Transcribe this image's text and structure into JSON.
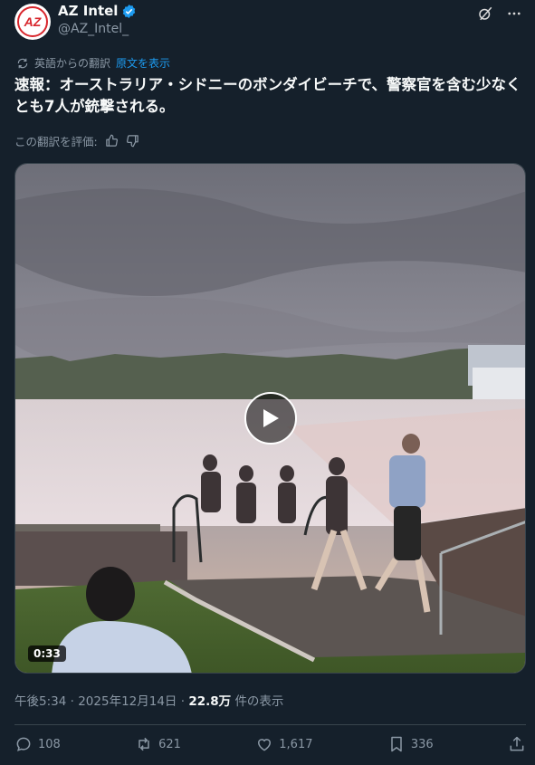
{
  "author": {
    "name": "AZ Intel",
    "handle": "@AZ_Intel_",
    "avatar_text": "AZ",
    "verified": true
  },
  "translation": {
    "label": "英語からの翻訳",
    "show_original": "原文を表示",
    "rate_label": "この翻訳を評価:"
  },
  "post": {
    "text": "速報：オーストラリア・シドニーのボンダイビーチで、警察官を含む少なくとも7人が銃撃される。"
  },
  "media": {
    "duration": "0:33"
  },
  "meta": {
    "time": "午後5:34",
    "date": "2025年12月14日",
    "views": "22.8万",
    "views_suffix": "件の表示"
  },
  "actions": {
    "replies": "108",
    "reposts": "621",
    "likes": "1,617",
    "bookmarks": "336"
  },
  "colors": {
    "background": "#15202b",
    "accent": "#1d9bf0",
    "muted": "#8b98a5",
    "brand_red": "#d8262c"
  }
}
